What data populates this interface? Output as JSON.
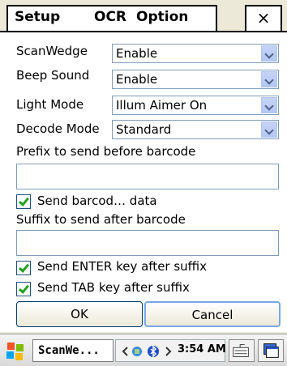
{
  "tabs": {
    "setup": "Setup",
    "ocr": "OCR",
    "option": "Option",
    "close": "×"
  },
  "form": {
    "scanwedge_label": "ScanWedge",
    "scanwedge_value": "Enable",
    "beep_label": "Beep Sound",
    "beep_value": "Enable",
    "light_label": "Light Mode",
    "light_value": "Illum Aimer On",
    "decode_label": "Decode Mode",
    "decode_value": "Standard",
    "prefix_label": "Prefix to send before barcode",
    "prefix_value": "",
    "send_barcode_label": "Send barcod… data",
    "send_barcode_checked": true,
    "suffix_label": "Suffix to send after barcode",
    "suffix_value": "",
    "send_enter_label": "Send ENTER key after suffix",
    "send_enter_checked": true,
    "send_tab_label": "Send TAB key after suffix",
    "send_tab_checked": true
  },
  "buttons": {
    "ok": "OK",
    "cancel": "Cancel"
  },
  "taskbar": {
    "task_label": "ScanWe...",
    "clock": "3:54 AM"
  },
  "colors": {
    "window_bg": "#ece9d8",
    "checkmark": "#21a121",
    "select_border": "#7f9db9"
  }
}
